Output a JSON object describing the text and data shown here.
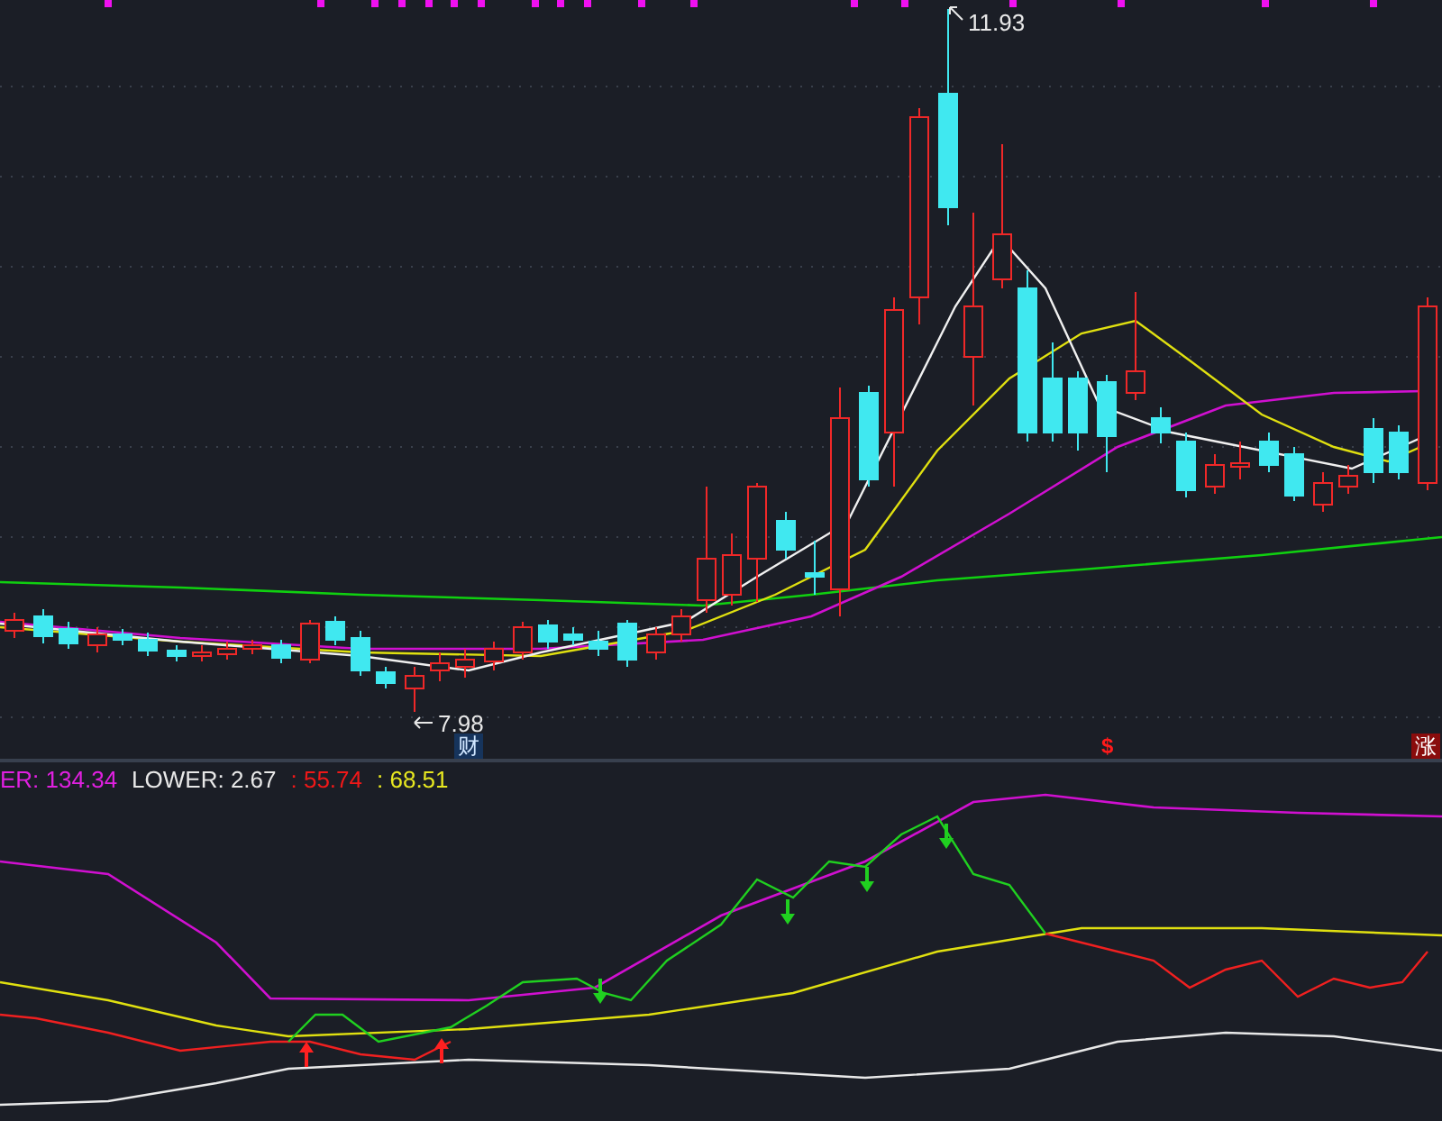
{
  "price_chart": {
    "high_label": "11.93",
    "low_label": "7.98",
    "markers": [
      {
        "kind": "finance",
        "text": "财"
      },
      {
        "kind": "dollar",
        "text": "$"
      },
      {
        "kind": "limit_up",
        "text": "涨"
      }
    ]
  },
  "indicator": {
    "legend": [
      {
        "text": "ER: 134.34",
        "color": "#e020e0"
      },
      {
        "text": "LOWER: 2.67",
        "color": "#e8e8e8"
      },
      {
        "text": ": 55.74",
        "color": "#f01818"
      },
      {
        "text": ": 68.51",
        "color": "#e8e820"
      }
    ]
  }
}
